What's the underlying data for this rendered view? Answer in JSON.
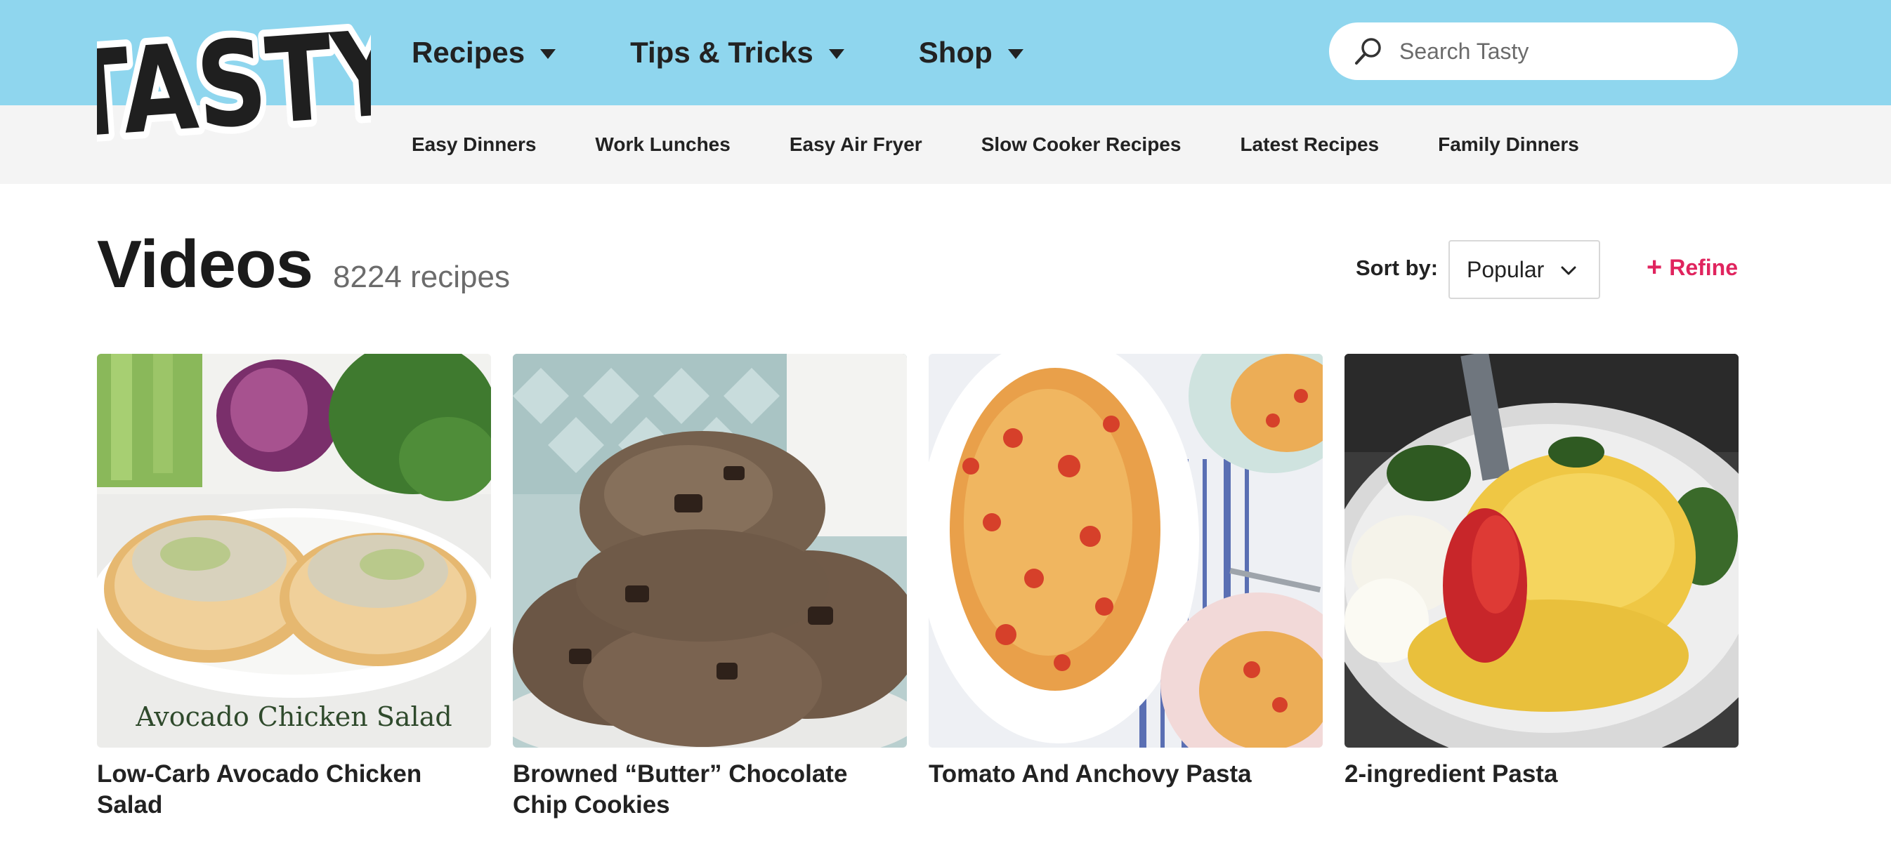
{
  "logo_text": "TASTY",
  "colors": {
    "header_bg": "#8fd6ee",
    "subnav_bg": "#f4f4f4",
    "accent": "#e0245e",
    "text": "#222222"
  },
  "nav": {
    "items": [
      {
        "label": "Recipes",
        "icon": "caret-down-icon"
      },
      {
        "label": "Tips & Tricks",
        "icon": "caret-down-icon"
      },
      {
        "label": "Shop",
        "icon": "caret-down-icon"
      }
    ]
  },
  "search": {
    "placeholder": "Search Tasty",
    "icon": "search-icon"
  },
  "subnav": {
    "items": [
      "Easy Dinners",
      "Work Lunches",
      "Easy Air Fryer",
      "Slow Cooker Recipes",
      "Latest Recipes",
      "Family Dinners"
    ]
  },
  "page": {
    "title": "Videos",
    "count": "8224 recipes"
  },
  "sort": {
    "label": "Sort by:",
    "value": "Popular",
    "icon": "chevron-down-icon"
  },
  "refine": {
    "label": "Refine",
    "icon": "+"
  },
  "cards": [
    {
      "title": "Low-Carb Avocado Chicken Salad",
      "thumb_caption": "Avocado Chicken Salad"
    },
    {
      "title": "Browned “Butter” Chocolate Chip Cookies"
    },
    {
      "title": "Tomato And Anchovy Pasta"
    },
    {
      "title": "2-ingredient Pasta"
    }
  ]
}
